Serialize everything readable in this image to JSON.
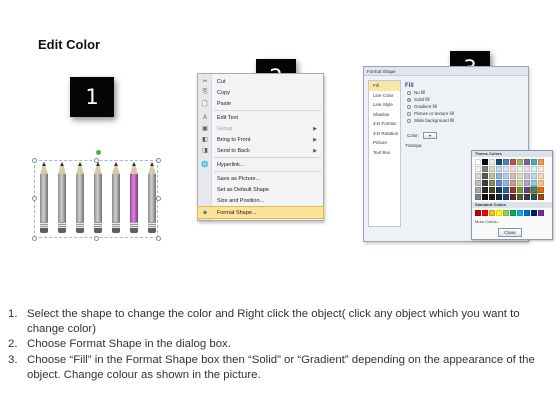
{
  "heading": "Edit Color",
  "badges": [
    "1",
    "2",
    "3"
  ],
  "pencils": [
    {
      "color": "#8a8a8a"
    },
    {
      "color": "#8a8a8a"
    },
    {
      "color": "#8a8a8a"
    },
    {
      "color": "#8a8a8a"
    },
    {
      "color": "#8a8a8a"
    },
    {
      "color": "#c06ac3"
    },
    {
      "color": "#8a8a8a"
    }
  ],
  "context_menu": {
    "items": [
      {
        "icon": "✂",
        "icon_name": "cut-icon",
        "label": "Cut",
        "enabled": true,
        "submenu": false
      },
      {
        "icon": "⎘",
        "icon_name": "copy-icon",
        "label": "Copy",
        "enabled": true,
        "submenu": false
      },
      {
        "icon": "📋",
        "icon_name": "paste-icon",
        "label": "Paste",
        "enabled": true,
        "submenu": false
      },
      {
        "icon": "A",
        "icon_name": "edit-text-icon",
        "label": "Edit Text",
        "enabled": true,
        "submenu": false
      },
      {
        "icon": "▣",
        "icon_name": "group-icon",
        "label": "Group",
        "enabled": false,
        "submenu": true
      },
      {
        "icon": "◧",
        "icon_name": "bring-to-front-icon",
        "label": "Bring to Front",
        "enabled": true,
        "submenu": true
      },
      {
        "icon": "◨",
        "icon_name": "send-to-back-icon",
        "label": "Send to Back",
        "enabled": true,
        "submenu": true
      },
      {
        "icon": "🌐",
        "icon_name": "hyperlink-icon",
        "label": "Hyperlink...",
        "enabled": true,
        "submenu": false
      },
      {
        "icon": "",
        "icon_name": "save-as-picture-icon",
        "label": "Save as Picture...",
        "enabled": true,
        "submenu": false
      },
      {
        "icon": "",
        "icon_name": "default-shape-icon",
        "label": "Set as Default Shape",
        "enabled": true,
        "submenu": false
      },
      {
        "icon": "",
        "icon_name": "size-position-icon",
        "label": "Size and Position...",
        "enabled": true,
        "submenu": false
      },
      {
        "icon": "◈",
        "icon_name": "format-shape-icon",
        "label": "Format Shape...",
        "enabled": true,
        "submenu": false,
        "highlighted": true
      }
    ]
  },
  "format_dialog": {
    "title": "Format Shape",
    "nav": [
      "Fill",
      "Line Color",
      "Line Style",
      "Shadow",
      "3-D Format",
      "3-D Rotation",
      "Picture",
      "Text Box"
    ],
    "active_nav": "Fill",
    "section_title": "Fill",
    "fill_options": [
      {
        "label": "No fill",
        "selected": false
      },
      {
        "label": "Solid fill",
        "selected": true
      },
      {
        "label": "Gradient fill",
        "selected": false
      },
      {
        "label": "Picture or texture fill",
        "selected": false
      },
      {
        "label": "Slide background fill",
        "selected": false
      }
    ],
    "color_label": "Color:",
    "transparency_label": "Transpa",
    "close_label": "Close",
    "palette": {
      "theme_title": "Theme Colors",
      "standard_title": "Standard Colors",
      "more_colors": "More Colors...",
      "theme_colors": [
        "#ffffff",
        "#000000",
        "#eeece1",
        "#1f497d",
        "#4f81bd",
        "#c0504d",
        "#9bbb59",
        "#8064a2",
        "#4bacc6",
        "#f79646",
        "#f2f2f2",
        "#7f7f7f",
        "#ddd9c3",
        "#c6d9f0",
        "#dbe5f1",
        "#f2dcdb",
        "#ebf1dd",
        "#e5e0ec",
        "#dbeef3",
        "#fdeada",
        "#d8d8d8",
        "#595959",
        "#c4bd97",
        "#8db3e2",
        "#b8cce4",
        "#e5b9b7",
        "#d7e3bc",
        "#ccc1d9",
        "#b7dde8",
        "#fbd5b5",
        "#bfbfbf",
        "#3f3f3f",
        "#938953",
        "#548dd4",
        "#95b3d7",
        "#d99694",
        "#c3d69b",
        "#b2a2c7",
        "#92cddc",
        "#fac08f",
        "#a5a5a5",
        "#262626",
        "#494429",
        "#17365d",
        "#366092",
        "#953734",
        "#76923c",
        "#5f497a",
        "#31859b",
        "#e36c09",
        "#7f7f7f",
        "#0c0c0c",
        "#1d1b10",
        "#0f243e",
        "#244061",
        "#632423",
        "#4f6128",
        "#3f3151",
        "#205867",
        "#974806"
      ],
      "standard_colors": [
        "#c00000",
        "#ff0000",
        "#ffc000",
        "#ffff00",
        "#92d050",
        "#00b050",
        "#00b0f0",
        "#0070c0",
        "#002060",
        "#7030a0"
      ]
    }
  },
  "instructions": [
    {
      "num": "1.",
      "text": "Select the shape to change the color and Right click the object( click any object which you want to change color)"
    },
    {
      "num": "2.",
      "text": "Choose Format Shape in the dialog box."
    },
    {
      "num": "3.",
      "text": "Choose “Fill” in the Format Shape box then “Solid” or “Gradient” depending on the appearance of the object. Change colour as shown in the picture."
    }
  ]
}
